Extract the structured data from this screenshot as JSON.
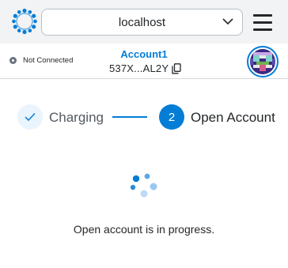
{
  "header": {
    "network_label": "localhost",
    "icons": {
      "logo": "ring-logo-icon",
      "chevron": "chevron-down-icon",
      "menu": "hamburger-menu-icon"
    }
  },
  "account_bar": {
    "connection_status": "Not Connected",
    "account_name": "Account1",
    "account_address": "537X...AL2Y",
    "icons": {
      "copy": "copy-icon",
      "avatar": "identicon-avatar"
    }
  },
  "stepper": {
    "steps": [
      {
        "label": "Charging",
        "state": "completed",
        "marker": "check-icon"
      },
      {
        "label": "Open Account",
        "state": "active",
        "number": "2"
      }
    ]
  },
  "content": {
    "status_text": "Open account is in progress."
  },
  "colors": {
    "accent": "#037dd6",
    "header_bg": "#f2f3f4",
    "text": "#24272a",
    "completed_step_bg": "#eaf4fd"
  }
}
